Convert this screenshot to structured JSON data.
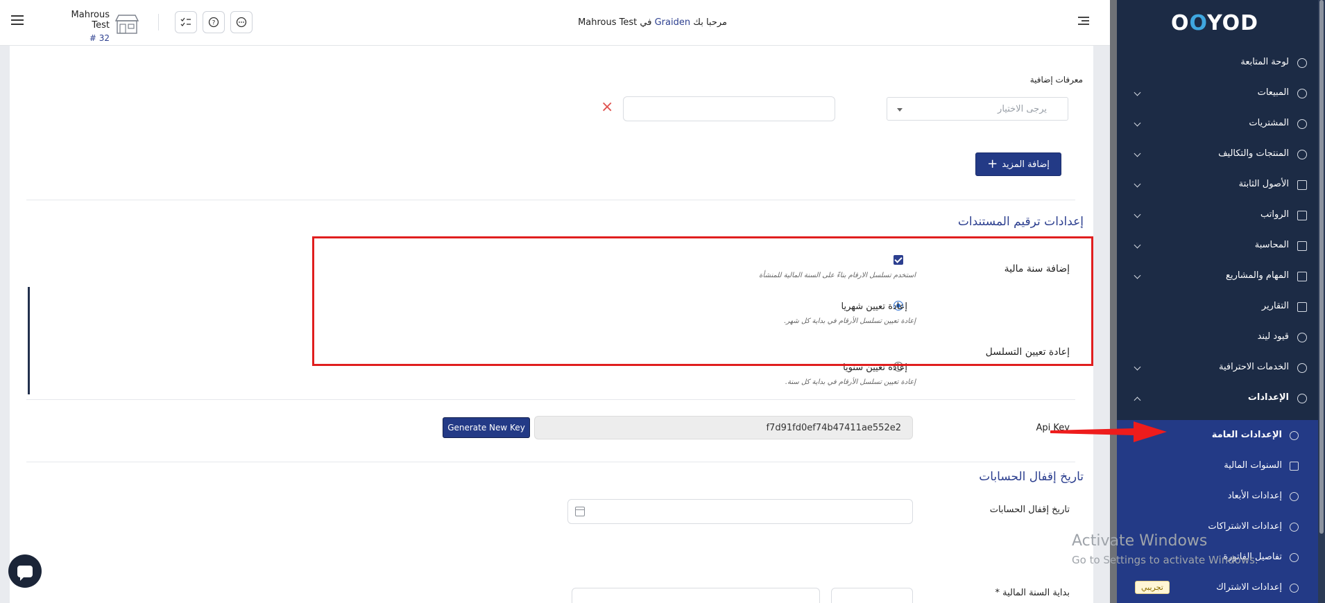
{
  "header": {
    "store_name": "Mahrous Test",
    "store_number": "# 32",
    "welcome_prefix": "مرحبا بك",
    "welcome_brand": "Graiden",
    "welcome_middle": "في",
    "welcome_company": "Mahrous Test"
  },
  "content": {
    "extra_ids_label": "معرفات إضافية",
    "select_placeholder": "يرجى الاختيار",
    "remove_symbol": "×",
    "add_more_label": "إضافة المزيد",
    "numbering_section_title": "إعدادات ترقيم المستندات",
    "fiscal_year_label": "إضافة سنة مالية",
    "fiscal_year_hint": "استخدم تسلسل الارقام بناءً على السنة المالية للمنشأة",
    "reset_sequence_label": "إعادة تعيين التسلسل",
    "monthly_label": "إعادة تعيين شهريا",
    "monthly_hint": "إعادة تعيين تسلسل الأرقام في بداية كل شهر.",
    "yearly_label": "إعادة تعيين سنويا",
    "yearly_hint": "إعادة تعيين تسلسل الأرقام في بداية كل سنة.",
    "api_key_label": "Api Key",
    "api_key_value": "f7d91fd0ef74b47411ae552e2",
    "generate_key_label": "Generate New Key",
    "closing_section_title": "تاريخ إقفال الحسابات",
    "closing_date_label": "تاريخ إقفال الحسابات",
    "fiscal_start_label": "بداية السنة المالية *"
  },
  "watermark": {
    "line1": "Activate Windows",
    "line2": "Go to Settings to activate Windows."
  },
  "sidebar": {
    "logo_part1": "O",
    "logo_dot": "O",
    "logo_part2": "YOD",
    "items": [
      {
        "label": "لوحة المتابعة",
        "icon": "dashboard-icon"
      },
      {
        "label": "المبيعات",
        "icon": "dollar-icon"
      },
      {
        "label": "المشتريات",
        "icon": "purchase-icon"
      },
      {
        "label": "المنتجات والتكاليف",
        "icon": "box-icon"
      },
      {
        "label": "الأصول الثابتة",
        "icon": "grid-icon"
      },
      {
        "label": "الرواتب",
        "icon": "folder-icon"
      },
      {
        "label": "المحاسبة",
        "icon": "folder-icon"
      },
      {
        "label": "المهام والمشاريع",
        "icon": "tasks-icon"
      },
      {
        "label": "التقارير",
        "icon": "report-icon"
      },
      {
        "label": "قيود لين‍د",
        "icon": "lend-icon"
      },
      {
        "label": "الخدمات الاحترافية",
        "icon": "services-icon"
      },
      {
        "label": "الإعدادات",
        "icon": "gear-icon"
      }
    ],
    "settings_sub": [
      {
        "label": "الإعدادات العامة",
        "icon": "gear-icon"
      },
      {
        "label": "السنوات المالية",
        "icon": "calendar-icon"
      },
      {
        "label": "إعدادات الأبعاد",
        "icon": "dimensions-icon"
      },
      {
        "label": "إعدادات الاشتراكات",
        "icon": "gear-icon"
      },
      {
        "label": "تفاصيل الفاتورة",
        "icon": "gear-icon"
      },
      {
        "label": "إعدادات الاشتراك",
        "icon": "gear-icon"
      }
    ],
    "trial_badge": "تجريبي"
  }
}
